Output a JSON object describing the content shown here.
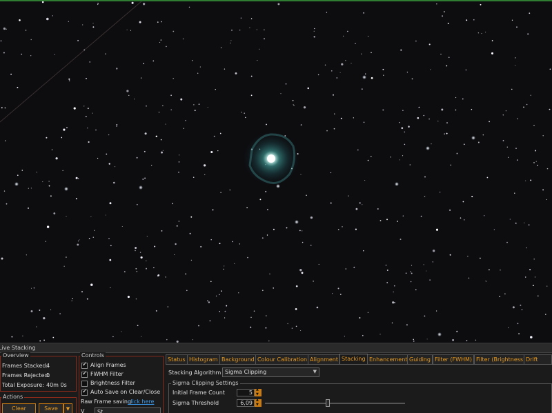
{
  "panel": {
    "title": "Live Stacking",
    "overview": {
      "title": "Overview",
      "frames_stacked_label": "Frames Stacked:",
      "frames_stacked_value": "4",
      "frames_rejected_label": "Frames Rejected:",
      "frames_rejected_value": "0",
      "total_exposure_label": "Total Exposure:",
      "total_exposure_value": "40m 0s"
    },
    "actions": {
      "title": "Actions",
      "clear_label": "Clear",
      "save_label": "Save"
    },
    "controls": {
      "title": "Controls",
      "align_frames": {
        "label": "Align Frames",
        "checked": true
      },
      "fwhm_filter": {
        "label": "FWHM Filter",
        "checked": true
      },
      "brightness_filter": {
        "label": "Brightness Filter",
        "checked": false
      },
      "auto_save": {
        "label": "Auto Save on Clear/Close",
        "checked": true
      },
      "raw_saving_label": "Raw Frame saving",
      "raw_saving_link": "click here",
      "view_label": "V",
      "view_value": "St"
    },
    "tabs": [
      {
        "label": "Status",
        "active": false
      },
      {
        "label": "Histogram",
        "active": false
      },
      {
        "label": "Background",
        "active": false
      },
      {
        "label": "Colour Calibration",
        "active": false
      },
      {
        "label": "Alignment",
        "active": false
      },
      {
        "label": "Stacking",
        "active": true
      },
      {
        "label": "Enhancement",
        "active": false
      },
      {
        "label": "Guiding",
        "active": false
      },
      {
        "label": "Filter (FWHM)",
        "active": false
      },
      {
        "label": "Filter (Brightness)",
        "active": false
      },
      {
        "label": "Drift Grap",
        "active": false
      }
    ],
    "stacking": {
      "algorithm_label": "Stacking Algorithm",
      "algorithm_value": "Sigma Clipping",
      "sigma_group_title": "Sigma Clipping Settings",
      "initial_frame_count_label": "Initial Frame Count",
      "initial_frame_count_value": "5",
      "sigma_threshold_label": "Sigma Threshold",
      "sigma_threshold_value": "6,09",
      "sigma_threshold_level": 0.45
    },
    "colors": {
      "accent": "#e69a20",
      "border": "#8a2a1a",
      "link": "#3a9cf0",
      "frame_top": "#2e7d32"
    }
  }
}
